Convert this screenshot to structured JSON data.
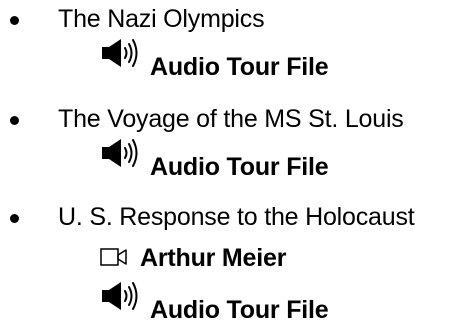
{
  "list": [
    {
      "title": "The Nazi Olympics",
      "media": [
        {
          "type": "audio",
          "icon": "speaker-icon",
          "label": "Audio Tour File"
        }
      ]
    },
    {
      "title": "The Voyage of the MS St. Louis",
      "media": [
        {
          "type": "audio",
          "icon": "speaker-icon",
          "label": "Audio Tour File"
        }
      ]
    },
    {
      "title": "U. S. Response to the Holocaust",
      "media": [
        {
          "type": "video",
          "icon": "video-camera-icon",
          "label": "Arthur Meier"
        },
        {
          "type": "audio",
          "icon": "speaker-icon",
          "label": "Audio Tour File"
        }
      ]
    }
  ]
}
